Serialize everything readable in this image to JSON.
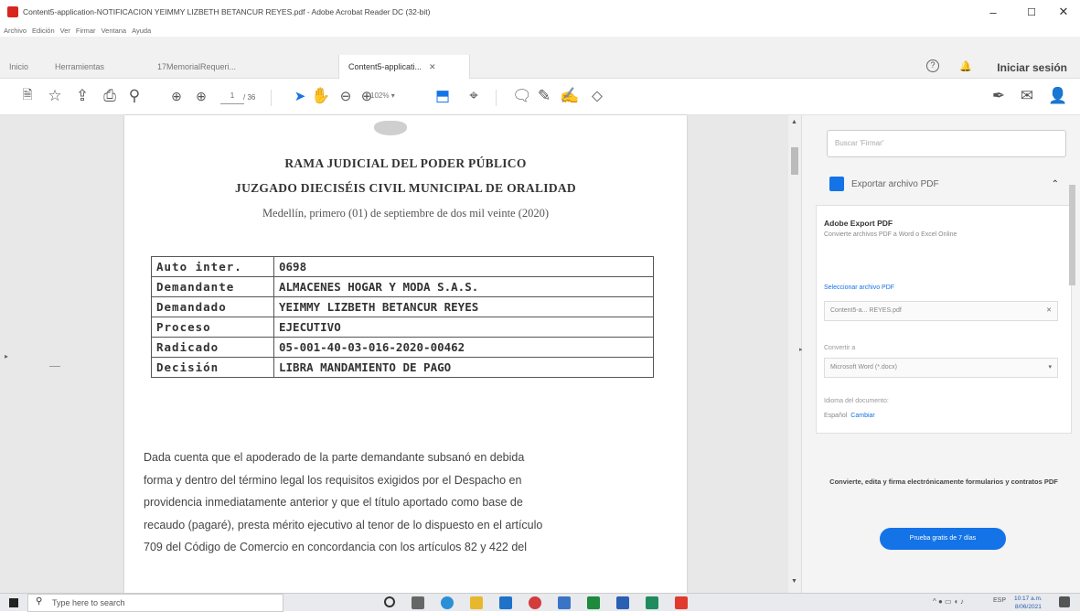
{
  "window": {
    "title": "Content5-application-NOTIFICACION YEIMMY LIZBETH BETANCUR REYES.pdf - Adobe Acrobat Reader DC (32-bit)",
    "minimize": "–",
    "maximize": "☐",
    "close": "✕"
  },
  "menu": [
    "Archivo",
    "Edición",
    "Ver",
    "Firmar",
    "Ventana",
    "Ayuda"
  ],
  "tabs": [
    {
      "label": "Inicio"
    },
    {
      "label": "Herramientas"
    },
    {
      "label": "17MemorialRequeri..."
    },
    {
      "label": "Content5-applicati...",
      "close": "✕"
    }
  ],
  "header": {
    "login": "Iniciar sesión"
  },
  "toolbar": {
    "page_current": "1",
    "page_total": "/ 36",
    "zoom": "102%"
  },
  "document": {
    "heading1": "RAMA JUDICIAL DEL PODER PÚBLICO",
    "heading2": "JUZGADO DIECISÉIS CIVIL MUNICIPAL DE ORALIDAD",
    "heading3": "Medellín, primero (01) de septiembre de dos mil veinte (2020)",
    "table": [
      {
        "key": "Auto inter.",
        "value": "0698"
      },
      {
        "key": "Demandante",
        "value": "ALMACENES HOGAR Y MODA S.A.S."
      },
      {
        "key": "Demandado",
        "value": "YEIMMY LIZBETH BETANCUR REYES"
      },
      {
        "key": "Proceso",
        "value": "EJECUTIVO"
      },
      {
        "key": "Radicado",
        "value": "05-001-40-03-016-2020-00462"
      },
      {
        "key": "Decisión",
        "value": "LIBRA MANDAMIENTO DE PAGO"
      }
    ],
    "paragraph_lines": [
      "Dada cuenta que el apoderado de la parte demandante subsanó en debida",
      "forma y dentro del término legal los requisitos exigidos por el Despacho en",
      "providencia inmediatamente anterior y que el título aportado como base de",
      "recaudo (pagaré), presta mérito ejecutivo al tenor de lo dispuesto en el artículo",
      "709 del Código de Comercio en concordancia con los artículos 82 y 422 del"
    ]
  },
  "panel": {
    "search_placeholder": "Buscar 'Firmar'",
    "export_title": "Exportar archivo PDF",
    "card_title": "Adobe Export PDF",
    "card_desc": "Convierte archivos PDF a Word o Excel Online",
    "select_label": "Seleccionar archivo PDF",
    "selected_file": "Content5-a... REYES.pdf",
    "convert_label": "Convertir a",
    "convert_value": "Microsoft Word (*.docx)",
    "lang_label": "Idioma del documento:",
    "lang_value": "Español",
    "lang_change": "Cambiar",
    "promo": "Convierte, edita y firma electrónicamente formularios y contratos PDF",
    "trial_button": "Prueba gratis de 7 días"
  },
  "taskbar": {
    "search_placeholder": "Type here to search",
    "time": "10:17 a.m.",
    "date": "8/06/2021",
    "lang": "ESP"
  },
  "colors": {
    "accent": "#1473e6",
    "acrobat_red": "#d7261e"
  }
}
